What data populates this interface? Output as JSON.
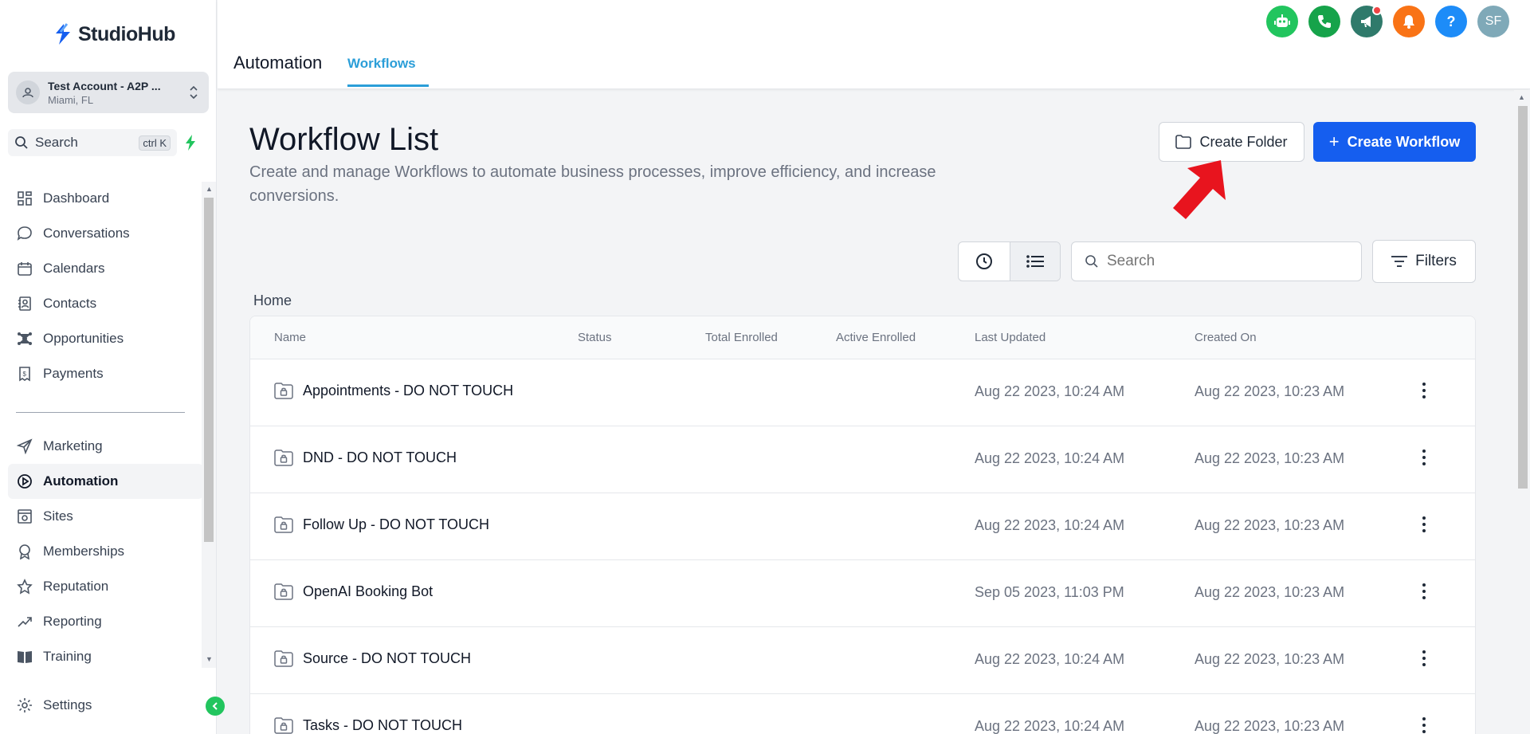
{
  "brand": {
    "name": "StudioHub",
    "accent": "#155eef"
  },
  "account": {
    "name": "Test Account - A2P ...",
    "location": "Miami, FL"
  },
  "sidebar_search": {
    "label": "Search",
    "shortcut": "ctrl K"
  },
  "nav": {
    "items": [
      {
        "label": "Dashboard",
        "icon": "dashboard-icon"
      },
      {
        "label": "Conversations",
        "icon": "chat-icon"
      },
      {
        "label": "Calendars",
        "icon": "calendar-icon"
      },
      {
        "label": "Contacts",
        "icon": "contacts-icon"
      },
      {
        "label": "Opportunities",
        "icon": "opportunities-icon"
      },
      {
        "label": "Payments",
        "icon": "payments-icon"
      }
    ],
    "items2": [
      {
        "label": "Marketing",
        "icon": "send-icon"
      },
      {
        "label": "Automation",
        "icon": "automation-icon",
        "active": true
      },
      {
        "label": "Sites",
        "icon": "sites-icon"
      },
      {
        "label": "Memberships",
        "icon": "award-icon"
      },
      {
        "label": "Reputation",
        "icon": "star-icon"
      },
      {
        "label": "Reporting",
        "icon": "trend-icon"
      },
      {
        "label": "Training",
        "icon": "book-icon"
      }
    ],
    "settings": "Settings"
  },
  "header": {
    "title": "Automation",
    "tab": "Workflows",
    "avatar_initials": "SF"
  },
  "page": {
    "title": "Workflow List",
    "subtitle": "Create and manage Workflows to automate business processes, improve efficiency, and increase conversions.",
    "create_folder": "Create Folder",
    "create_workflow": "Create Workflow",
    "search_placeholder": "Search",
    "filters": "Filters",
    "breadcrumb": "Home"
  },
  "table": {
    "columns": [
      "Name",
      "Status",
      "Total Enrolled",
      "Active Enrolled",
      "Last Updated",
      "Created On"
    ],
    "rows": [
      {
        "name": "Appointments - DO NOT TOUCH",
        "updated": "Aug 22 2023, 10:24 AM",
        "created": "Aug 22 2023, 10:23 AM"
      },
      {
        "name": "DND - DO NOT TOUCH",
        "updated": "Aug 22 2023, 10:24 AM",
        "created": "Aug 22 2023, 10:23 AM"
      },
      {
        "name": "Follow Up - DO NOT TOUCH",
        "updated": "Aug 22 2023, 10:24 AM",
        "created": "Aug 22 2023, 10:23 AM"
      },
      {
        "name": "OpenAI Booking Bot",
        "updated": "Sep 05 2023, 11:03 PM",
        "created": "Aug 22 2023, 10:23 AM"
      },
      {
        "name": "Source - DO NOT TOUCH",
        "updated": "Aug 22 2023, 10:24 AM",
        "created": "Aug 22 2023, 10:23 AM"
      },
      {
        "name": "Tasks - DO NOT TOUCH",
        "updated": "Aug 22 2023, 10:24 AM",
        "created": "Aug 22 2023, 10:23 AM"
      }
    ]
  }
}
